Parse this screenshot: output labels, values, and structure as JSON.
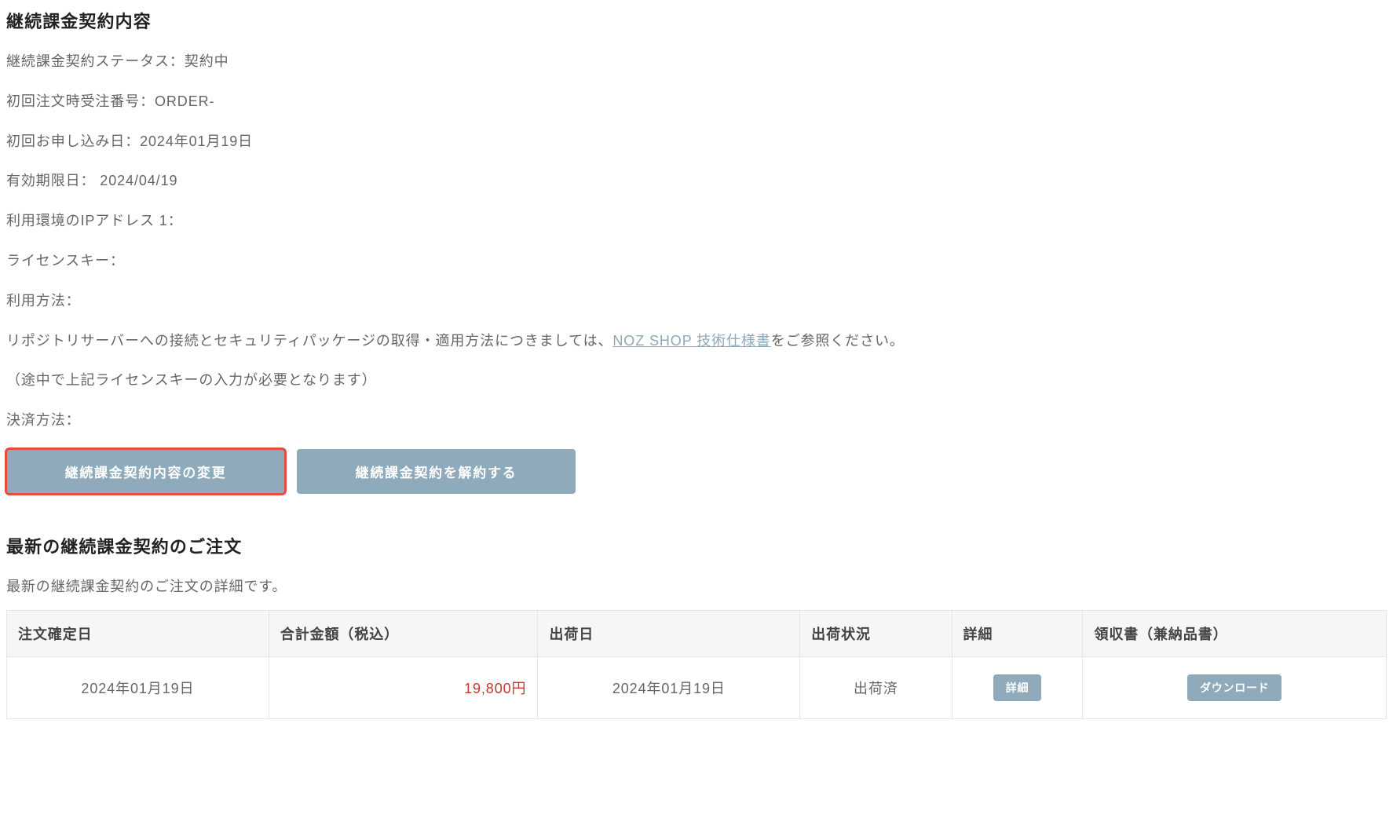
{
  "contract": {
    "heading": "継続課金契約内容",
    "status_line": "継続課金契約ステータス：契約中",
    "order_number_line": "初回注文時受注番号：ORDER-",
    "first_apply_line": "初回お申し込み日：2024年01月19日",
    "expiry_line": "有効期限日： 2024/04/19",
    "ip_line": "利用環境のIPアドレス 1：",
    "license_line": "ライセンスキー：",
    "usage_label": "利用方法：",
    "usage_pre_link": "リポジトリサーバーへの接続とセキュリティパッケージの取得・適用方法につきましては、",
    "usage_link_text": "NOZ SHOP 技術仕様書",
    "usage_post_link": "をご参照ください。",
    "usage_note": "（途中で上記ライセンスキーの入力が必要となります）",
    "payment_line": "決済方法："
  },
  "buttons": {
    "change": "継続課金契約内容の変更",
    "cancel": "継続課金契約を解約する"
  },
  "latest_order": {
    "heading": "最新の継続課金契約のご注文",
    "subtitle": "最新の継続課金契約のご注文の詳細です。",
    "columns": {
      "order_date": "注文確定日",
      "total": "合計金額（税込）",
      "ship_date": "出荷日",
      "ship_status": "出荷状況",
      "detail": "詳細",
      "receipt": "領収書（兼納品書）"
    },
    "row": {
      "order_date": "2024年01月19日",
      "total": "19,800円",
      "ship_date": "2024年01月19日",
      "ship_status": "出荷済",
      "detail_btn": "詳細",
      "receipt_btn": "ダウンロード"
    }
  }
}
